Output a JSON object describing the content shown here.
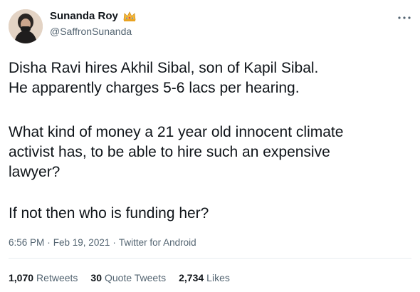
{
  "tweet": {
    "author": {
      "display_name": "Sunanda Roy",
      "handle": "@SaffronSunanda",
      "badge_icon": "crown-emoji-icon"
    },
    "more_icon": "more-dots-icon",
    "text": {
      "paragraph_1": "Disha Ravi hires Akhil Sibal, son of Kapil Sibal.\nHe apparently charges 5-6 lacs per hearing.",
      "paragraph_2": "What kind of money a 21 year old innocent climate\nactivist has, to be able to  hire such an expensive\nlawyer?",
      "paragraph_3": "If not then who is funding her?"
    },
    "meta": {
      "time": "6:56 PM",
      "separator_1": "·",
      "date": "Feb 19, 2021",
      "separator_2": "·",
      "source": "Twitter for Android"
    },
    "stats": {
      "retweets_count": "1,070",
      "retweets_label": "Retweets",
      "quotes_count": "30",
      "quotes_label": "Quote Tweets",
      "likes_count": "2,734",
      "likes_label": "Likes"
    }
  },
  "colors": {
    "text_primary": "#0f1419",
    "text_secondary": "#536471",
    "divider": "#e6ecf0",
    "badge": "#f4b73a"
  }
}
